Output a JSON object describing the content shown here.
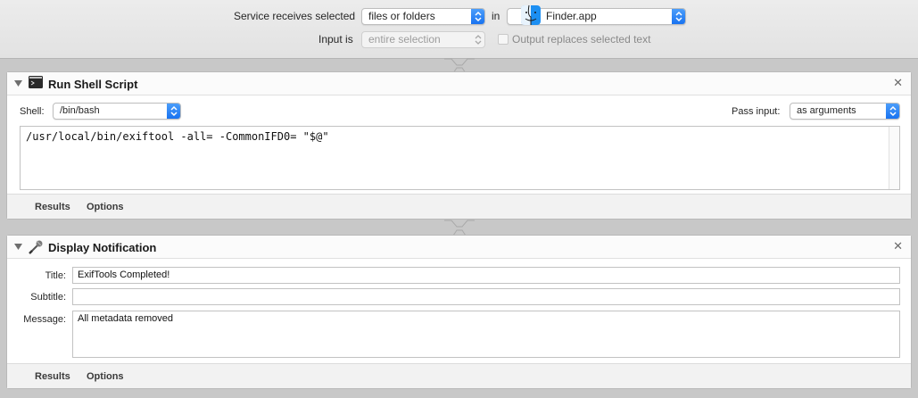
{
  "service": {
    "receives_label": "Service receives selected",
    "receives_value": "files or folders",
    "in_label": "in",
    "app_value": "Finder.app",
    "input_label": "Input is",
    "input_value": "entire selection",
    "output_checkbox_label": "Output replaces selected text",
    "output_checked": false
  },
  "actions": [
    {
      "title": "Run Shell Script",
      "icon": "terminal-icon",
      "shell_label": "Shell:",
      "shell_value": "/bin/bash",
      "pass_input_label": "Pass input:",
      "pass_input_value": "as arguments",
      "script": "/usr/local/bin/exiftool -all= -CommonIFD0= \"$@\"",
      "footer": {
        "results": "Results",
        "options": "Options"
      }
    },
    {
      "title": "Display Notification",
      "icon": "notification-icon",
      "title_label": "Title:",
      "title_value": "ExifTools Completed!",
      "subtitle_label": "Subtitle:",
      "subtitle_value": "",
      "message_label": "Message:",
      "message_value": "All metadata removed",
      "footer": {
        "results": "Results",
        "options": "Options"
      }
    }
  ],
  "colors": {
    "accent": "#1570f0",
    "background": "#c8c8c8",
    "panel": "#ffffff"
  }
}
